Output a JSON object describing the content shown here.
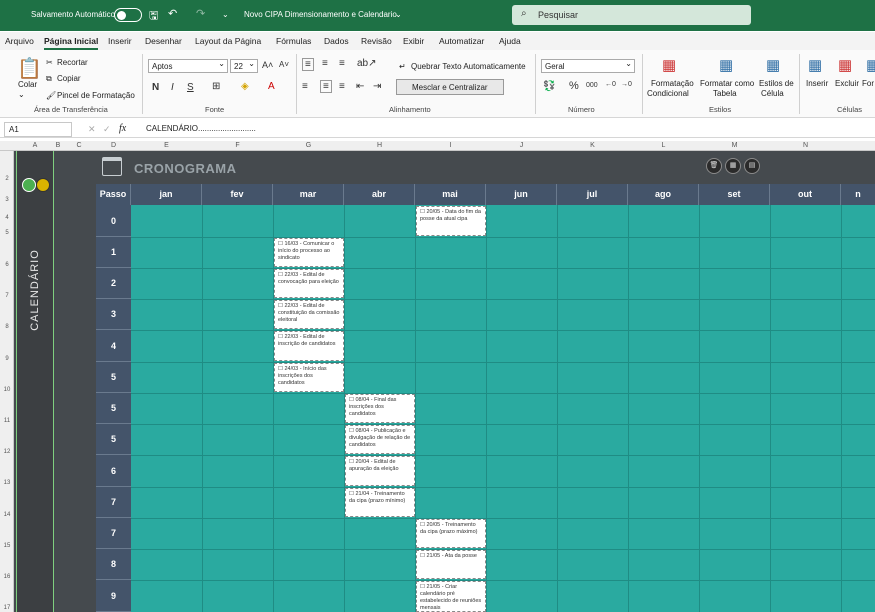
{
  "titlebar": {
    "autosave_label": "Salvamento Automático",
    "doc_title": "Novo CIPA Dimensionamento e Calendario",
    "search_placeholder": "Pesquisar"
  },
  "menu": [
    "Arquivo",
    "Página Inicial",
    "Inserir",
    "Desenhar",
    "Layout da Página",
    "Fórmulas",
    "Dados",
    "Revisão",
    "Exibir",
    "Automatizar",
    "Ajuda"
  ],
  "ribbon": {
    "paste": "Colar",
    "cut": "Recortar",
    "copy": "Copiar",
    "format_painter": "Pincel de Formatação",
    "group_clipboard": "Área de Transferência",
    "font_name": "Aptos",
    "font_size": "22",
    "group_font": "Fonte",
    "wrap_text": "Quebrar Texto Automaticamente",
    "merge_center": "Mesclar e Centralizar",
    "group_alignment": "Alinhamento",
    "number_format": "Geral",
    "group_number": "Número",
    "conditional_1": "Formatação",
    "conditional_2": "Condicional",
    "format_table_1": "Formatar como",
    "format_table_2": "Tabela",
    "cell_styles_1": "Estilos de",
    "cell_styles_2": "Célula",
    "group_styles": "Estilos",
    "insert": "Inserir",
    "delete": "Excluir",
    "format": "For",
    "group_cells": "Células"
  },
  "formula": {
    "namebox": "A1",
    "content": "CALENDÁRIO.........................."
  },
  "columns": [
    "A",
    "B",
    "C",
    "D",
    "E",
    "F",
    "G",
    "H",
    "I",
    "J",
    "K",
    "L",
    "M",
    "N"
  ],
  "rows": [
    "2",
    "3",
    "4",
    "5",
    "6",
    "7",
    "8",
    "9",
    "10",
    "11",
    "12",
    "13",
    "14",
    "15",
    "16",
    "17"
  ],
  "sheet": {
    "side_label": "CALENDÁRIO",
    "header": "CRONOGRAMA",
    "passo_label": "Passo",
    "months": [
      "jan",
      "fev",
      "mar",
      "abr",
      "mai",
      "jun",
      "jul",
      "ago",
      "set",
      "out",
      "n"
    ],
    "steps": [
      "0",
      "1",
      "2",
      "3",
      "4",
      "5",
      "5",
      "5",
      "6",
      "7",
      "7",
      "8",
      "9"
    ]
  },
  "tasks": {
    "t0": "☐ 20/05 - Data do fim da posse da atual cipa",
    "t1": "☐ 16/03 - Comunicar o início do processo ao sindicato",
    "t2": "☐ 22/03 - Edital de convocação para eleição",
    "t3": "☐ 22/03 - Edital de constituição da comissão eleitoral",
    "t4": "☐ 22/03 - Edital de inscrição de candidatos",
    "t5": "☐ 24/03 - Início das inscrições dos candidatos",
    "t6": "☐ 08/04 - Final das inscrições dos candidatos",
    "t7": "☐ 08/04 - Publicação e divulgação de relação de candidatos",
    "t8": "☐ 20/04 - Edital de apuração da eleição",
    "t9": "☐ 21/04 - Treinamento da cipa (prazo mínimo)",
    "t10": "☐ 20/05 - Treinamento da cipa (prazo máximo)",
    "t11": "☐ 21/05 - Ata da posse",
    "t12": "☐ 21/05 - Criar calendário pré estabelecido de reuniões mensais"
  },
  "colors": {
    "title_bar": "#1e7145",
    "teal": "#2aaaa0",
    "header": "#44546a",
    "panel": "#3c3f42"
  }
}
